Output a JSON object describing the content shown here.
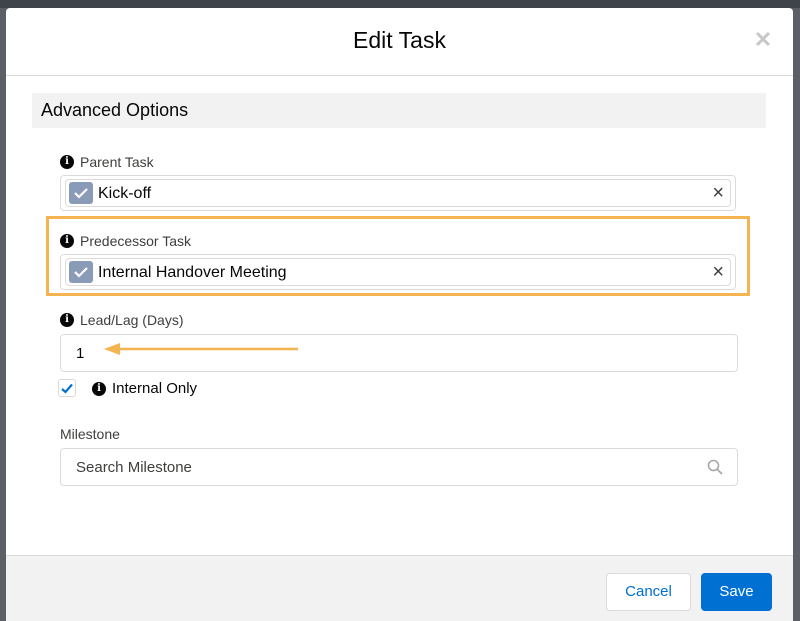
{
  "modal": {
    "title": "Edit Task",
    "close_icon": "close-icon"
  },
  "section": {
    "title": "Advanced Options"
  },
  "fields": {
    "parent_task": {
      "label": "Parent Task",
      "value": "Kick-off",
      "remove_icon": "×"
    },
    "predecessor_task": {
      "label": "Predecessor Task",
      "value": "Internal Handover Meeting",
      "remove_icon": "×"
    },
    "lead_lag": {
      "label": "Lead/Lag (Days)",
      "value": "1"
    },
    "internal_only": {
      "label": "Internal Only",
      "checked": true
    },
    "milestone": {
      "label": "Milestone",
      "placeholder": "Search Milestone"
    }
  },
  "footer": {
    "cancel_label": "Cancel",
    "save_label": "Save"
  },
  "colors": {
    "highlight": "#f4b450",
    "primary": "#0070d2",
    "pill_icon": "#8a9bb8"
  }
}
